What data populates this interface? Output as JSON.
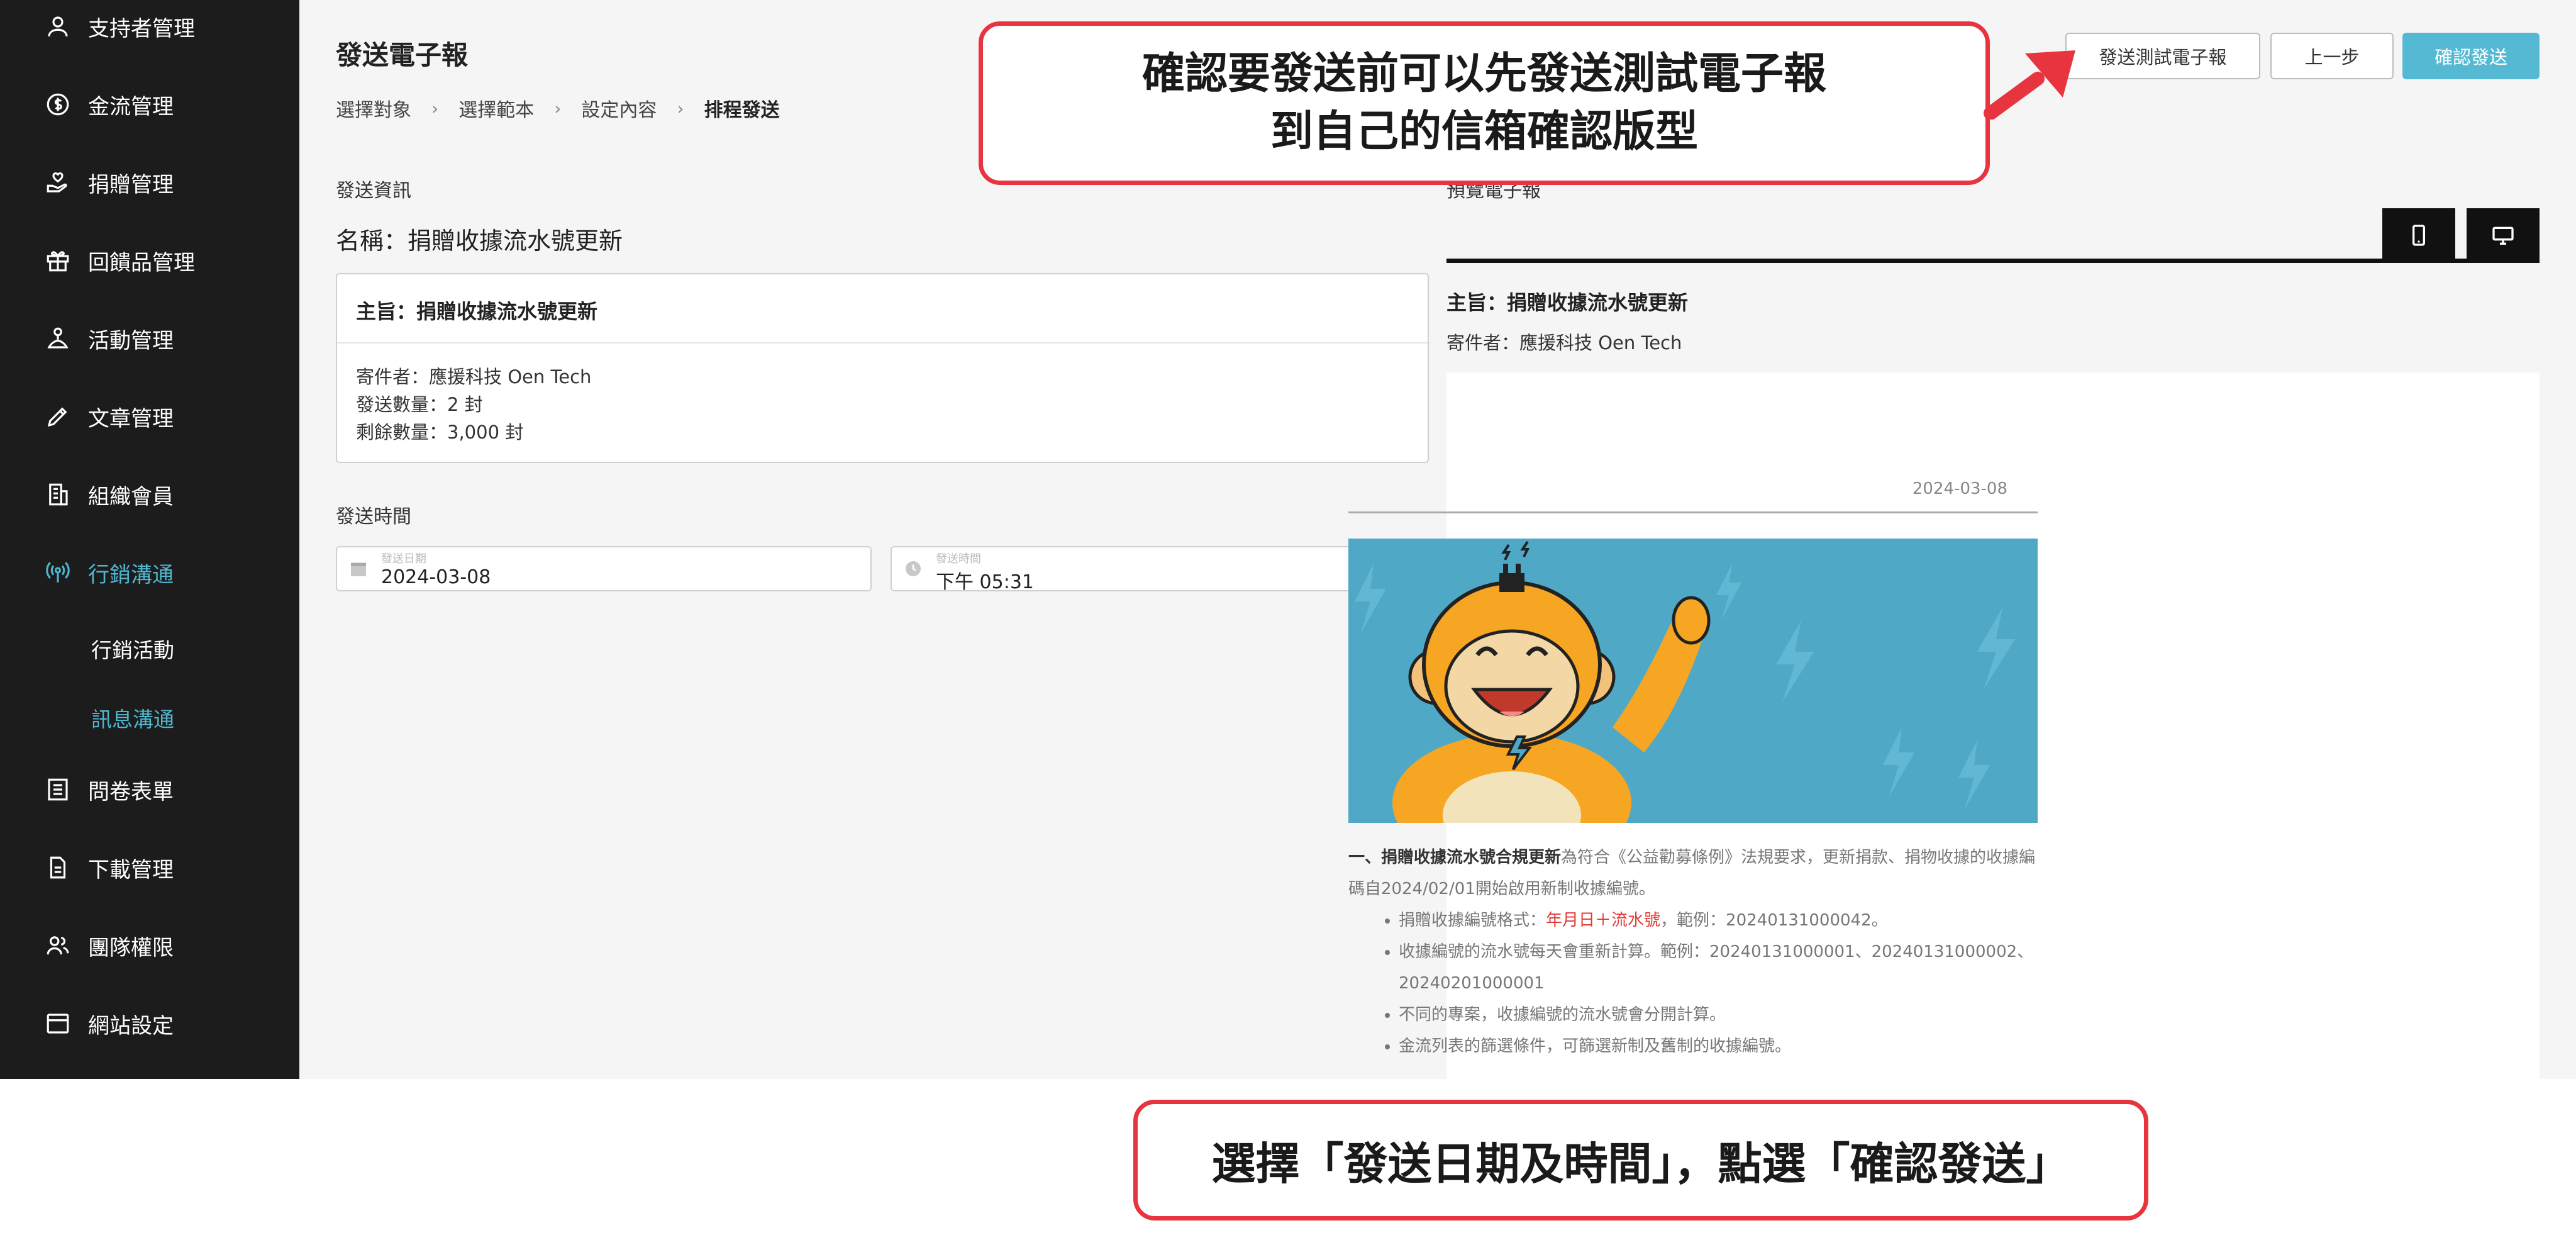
{
  "sidebar": {
    "items": [
      {
        "label": "支持者管理",
        "icon": "person-icon"
      },
      {
        "label": "金流管理",
        "icon": "dollar-coin-icon"
      },
      {
        "label": "捐贈管理",
        "icon": "hand-heart-icon"
      },
      {
        "label": "回饋品管理",
        "icon": "gift-icon"
      },
      {
        "label": "活動管理",
        "icon": "event-icon"
      },
      {
        "label": "文章管理",
        "icon": "pen-icon"
      },
      {
        "label": "組織會員",
        "icon": "building-icon"
      },
      {
        "label": "行銷溝通",
        "icon": "broadcast-icon",
        "active": true
      },
      {
        "label": "問卷表單",
        "icon": "list-icon"
      },
      {
        "label": "下載管理",
        "icon": "document-icon"
      },
      {
        "label": "團隊權限",
        "icon": "team-icon"
      },
      {
        "label": "網站設定",
        "icon": "browser-window-icon"
      }
    ],
    "subitems": [
      {
        "label": "行銷活動"
      },
      {
        "label": "訊息溝通",
        "active": true
      }
    ],
    "accent_color": "#4fb6cf"
  },
  "main": {
    "title": "發送電子報",
    "breadcrumb": [
      "選擇對象",
      "選擇範本",
      "設定內容",
      "排程發送"
    ],
    "breadcrumb_sep": "›",
    "send_info_label": "發送資訊",
    "name": "名稱：捐贈收據流水號更新",
    "card": {
      "subject": "主旨：捐贈收據流水號更新",
      "sender": "寄件者：應援科技 Oen Tech",
      "send_count": "發送數量：2 封",
      "remaining": "剩餘數量：3,000 封"
    },
    "send_time_label": "發送時間",
    "date_field": {
      "label": "發送日期",
      "value": "2024-03-08"
    },
    "time_field": {
      "label": "發送時間",
      "value": "下午 05:31"
    }
  },
  "toolbar": {
    "test_send_label": "發送測試電子報",
    "back_label": "上一步",
    "confirm_label": "確認發送",
    "primary_color": "#56b9d3"
  },
  "preview": {
    "label": "預覽電子報",
    "subject": "主旨：捐贈收據流水號更新",
    "sender": "寄件者：應援科技 Oen Tech",
    "date": "2024-03-08",
    "para_bold": "一、捐贈收據流水號合規更新",
    "para_rest": "為符合《公益勸募條例》法規要求，更新捐款、捐物收據的收據編碼自2024/02/01開始啟用新制收據編號。",
    "bullet1_pre": "捐贈收據編號格式：",
    "bullet1_red": "年月日＋流水號",
    "bullet1_post": "，範例：20240131000042。",
    "bullet2": "收據編號的流水號每天會重新計算。範例：20240131000001、20240131000002、20240201000001",
    "bullet3": "不同的專案，收據編號的流水號會分開計算。",
    "bullet4": "金流列表的篩選條件，可篩選新制及舊制的收據編號。"
  },
  "callouts": {
    "top_line1": "確認要發送前可以先發送測試電子報",
    "top_line2": "到自己的信箱確認版型",
    "bottom": "選擇「發送日期及時間」，點選「確認發送」",
    "border_color": "#e8343f"
  }
}
